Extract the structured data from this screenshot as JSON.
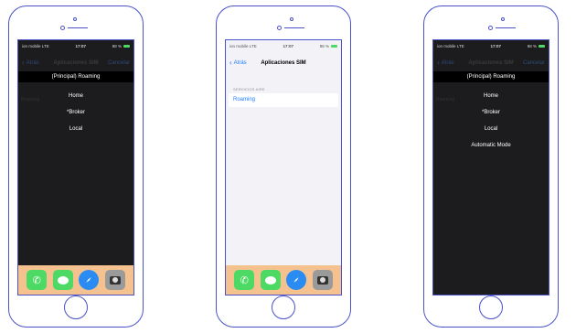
{
  "status": {
    "carrier": "ion mobile",
    "network": "LTE",
    "time": "17:07",
    "battery": "88 %"
  },
  "nav": {
    "back_label": "Atrás",
    "title": "Aplicaciones SIM",
    "cancel_label": "Cancelar"
  },
  "screen1": {
    "picker_header": "(Principal) Roaming",
    "ghost_label": "Roaming",
    "options": [
      "Home",
      "*Broker",
      "Local"
    ]
  },
  "screen2": {
    "section_header": "SERVICIOS AIRE",
    "cell_label": "Roaming"
  },
  "screen3": {
    "picker_header": "(Principal) Roaming",
    "ghost_label": "Roaming",
    "options": [
      "Home",
      "*Broker",
      "Local",
      "Automatic Mode"
    ]
  },
  "dock": {
    "icons": [
      "phone-icon",
      "messages-icon",
      "safari-icon",
      "camera-icon"
    ]
  },
  "colors": {
    "outline": "#4a52c8",
    "accent": "#1e7cff",
    "dock": "#f5c18f"
  }
}
